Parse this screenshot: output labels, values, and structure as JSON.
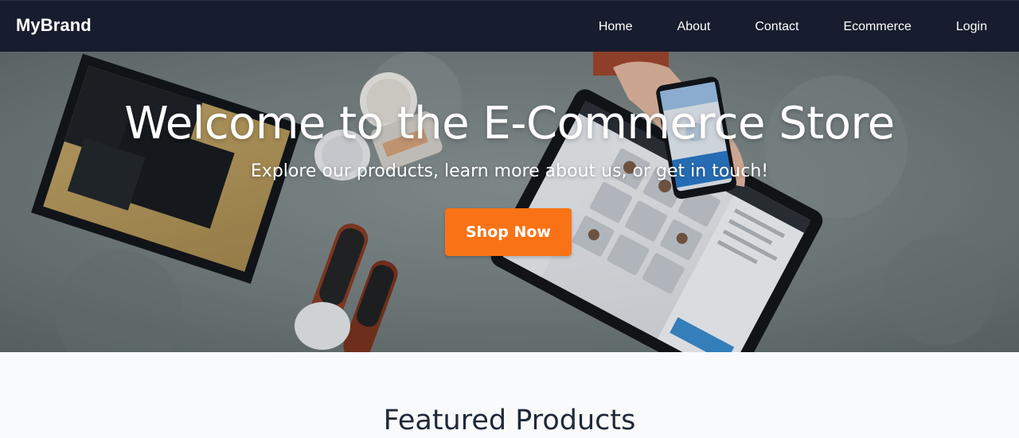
{
  "brand": {
    "name": "MyBrand"
  },
  "nav": {
    "items": [
      {
        "label": "Home"
      },
      {
        "label": "About"
      },
      {
        "label": "Contact"
      },
      {
        "label": "Ecommerce"
      },
      {
        "label": "Login"
      }
    ]
  },
  "hero": {
    "title": "Welcome to the E-Commerce Store",
    "subtitle": "Explore our products, learn more about us, or get in touch!",
    "cta_label": "Shop Now"
  },
  "featured": {
    "title": "Featured Products"
  },
  "colors": {
    "navbar_bg": "#171d2e",
    "cta_bg": "#f97316",
    "page_bg": "#f8fafc",
    "heading_text": "#1f2937"
  }
}
